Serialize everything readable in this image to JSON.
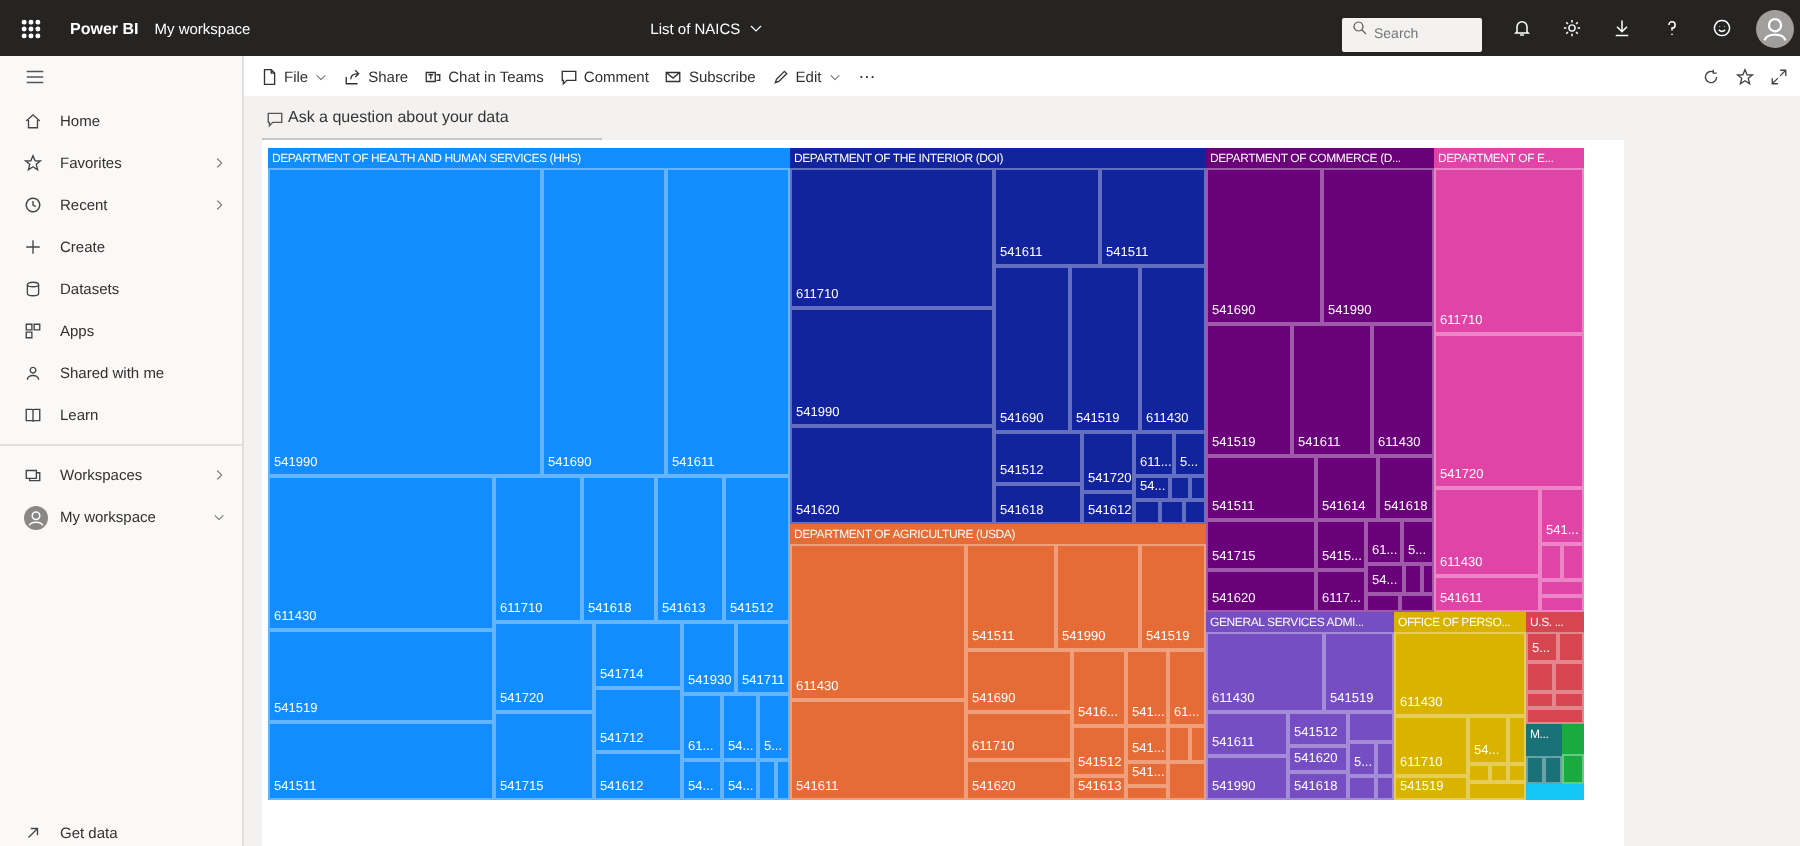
{
  "app_bar": {
    "app_name": "Power BI",
    "workspace": "My workspace",
    "report_title": "List of NAICS",
    "search": {
      "placeholder": "Search"
    }
  },
  "toolbar": {
    "items": [
      {
        "label": "File",
        "kind": "menu"
      },
      {
        "label": "Share",
        "kind": "button"
      },
      {
        "label": "Chat in Teams",
        "kind": "button"
      },
      {
        "label": "Comment",
        "kind": "button"
      },
      {
        "label": "Subscribe",
        "kind": "button"
      },
      {
        "label": "Edit",
        "kind": "menu"
      }
    ]
  },
  "qna": {
    "placeholder": "Ask a question about your data"
  },
  "sidebar": {
    "sections": [
      {
        "items": [
          {
            "label": "Home",
            "kind": "link"
          },
          {
            "label": "Favorites",
            "kind": "expandable",
            "expanded": false
          },
          {
            "label": "Recent",
            "kind": "expandable",
            "expanded": false
          },
          {
            "label": "Create",
            "kind": "link"
          },
          {
            "label": "Datasets",
            "kind": "link"
          },
          {
            "label": "Apps",
            "kind": "link"
          },
          {
            "label": "Shared with me",
            "kind": "link"
          },
          {
            "label": "Learn",
            "kind": "link"
          }
        ]
      },
      {
        "items": [
          {
            "label": "Workspaces",
            "kind": "expandable",
            "expanded": false
          },
          {
            "label": "My workspace",
            "kind": "expandable",
            "expanded": true
          }
        ]
      }
    ],
    "footer": "Get data"
  },
  "treemap": {
    "groups": [
      {
        "label": "DEPARTMENT OF HEALTH AND HUMAN SERVICES (HHS)",
        "color": "#118dff",
        "tiles": [
          {
            "label": "541990"
          },
          {
            "label": "541690"
          },
          {
            "label": "541611"
          },
          {
            "label": "611430"
          },
          {
            "label": "611710"
          },
          {
            "label": "541618"
          },
          {
            "label": "541613"
          },
          {
            "label": "541512"
          },
          {
            "label": "541519"
          },
          {
            "label": "541511"
          },
          {
            "label": "541720"
          },
          {
            "label": "541715"
          },
          {
            "label": "541714"
          },
          {
            "label": "541712"
          },
          {
            "label": "541612"
          },
          {
            "label": "541930"
          },
          {
            "label": "541711"
          },
          {
            "label": "61..."
          },
          {
            "label": "54..."
          },
          {
            "label": "5..."
          },
          {
            "label": "54..."
          },
          {
            "label": "54..."
          }
        ]
      },
      {
        "label": "DEPARTMENT OF THE INTERIOR (DOI)",
        "color": "#12239e",
        "tiles": [
          {
            "label": "611710"
          },
          {
            "label": "541611"
          },
          {
            "label": "541511"
          },
          {
            "label": "541990"
          },
          {
            "label": "541620"
          },
          {
            "label": "541690"
          },
          {
            "label": "541519"
          },
          {
            "label": "611430"
          },
          {
            "label": "541512"
          },
          {
            "label": "541618"
          },
          {
            "label": "541720"
          },
          {
            "label": "541612"
          },
          {
            "label": "611..."
          },
          {
            "label": "5..."
          },
          {
            "label": "54..."
          }
        ]
      },
      {
        "label": "DEPARTMENT OF AGRICULTURE (USDA)",
        "color": "#e66c37",
        "tiles": [
          {
            "label": "611430"
          },
          {
            "label": "541611"
          },
          {
            "label": "541511"
          },
          {
            "label": "541990"
          },
          {
            "label": "541519"
          },
          {
            "label": "541690"
          },
          {
            "label": "611710"
          },
          {
            "label": "541620"
          },
          {
            "label": "5416..."
          },
          {
            "label": "541..."
          },
          {
            "label": "61..."
          },
          {
            "label": "541512"
          },
          {
            "label": "541613"
          },
          {
            "label": "541..."
          },
          {
            "label": "541..."
          }
        ]
      },
      {
        "label": "DEPARTMENT OF COMMERCE (D...",
        "color": "#6b007b",
        "tiles": [
          {
            "label": "541690"
          },
          {
            "label": "541990"
          },
          {
            "label": "541519"
          },
          {
            "label": "541611"
          },
          {
            "label": "611430"
          },
          {
            "label": "541511"
          },
          {
            "label": "541614"
          },
          {
            "label": "541618"
          },
          {
            "label": "541715"
          },
          {
            "label": "541620"
          },
          {
            "label": "5415..."
          },
          {
            "label": "6117..."
          },
          {
            "label": "61..."
          },
          {
            "label": "5..."
          },
          {
            "label": "54..."
          }
        ]
      },
      {
        "label": "DEPARTMENT OF E...",
        "color": "#e044a7",
        "tiles": [
          {
            "label": "611710"
          },
          {
            "label": "541720"
          },
          {
            "label": "611430"
          },
          {
            "label": "541611"
          },
          {
            "label": "541..."
          }
        ]
      },
      {
        "label": "GENERAL SERVICES ADMI...",
        "color": "#744ec2",
        "tiles": [
          {
            "label": "611430"
          },
          {
            "label": "541519"
          },
          {
            "label": "541611"
          },
          {
            "label": "541990"
          },
          {
            "label": "541512"
          },
          {
            "label": "541620"
          },
          {
            "label": "541618"
          },
          {
            "label": "5..."
          }
        ]
      },
      {
        "label": "OFFICE OF PERSO...",
        "color": "#d9b300",
        "tiles": [
          {
            "label": "611430"
          },
          {
            "label": "611710"
          },
          {
            "label": "541519"
          },
          {
            "label": "54..."
          }
        ]
      },
      {
        "label": "U.S. ...",
        "color": "#d64550",
        "tiles": [
          {
            "label": "5..."
          }
        ]
      },
      {
        "label": "M...",
        "color": "#197278"
      },
      {
        "color": "#1aab40"
      },
      {
        "color": "#15c6f4"
      }
    ]
  }
}
